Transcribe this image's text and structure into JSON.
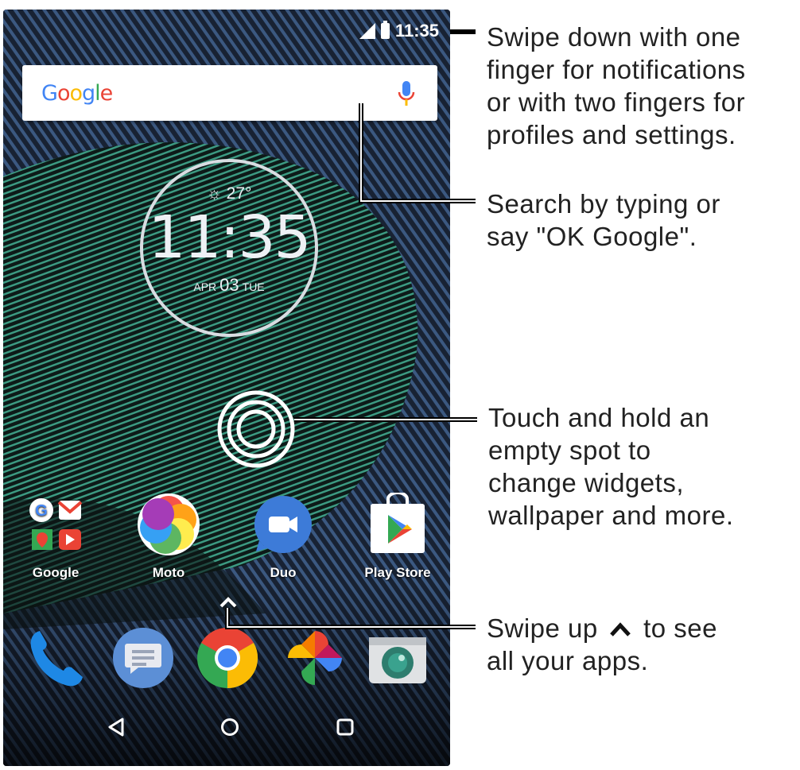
{
  "status_bar": {
    "time": "11:35",
    "signal_icon": "signal-icon",
    "battery_icon": "battery-icon"
  },
  "search_bar": {
    "logo": "Google",
    "mic_icon": "mic-icon"
  },
  "clock_widget": {
    "weather": "27°",
    "weather_icon": "sun-icon",
    "time": "11:35",
    "month": "APR",
    "day": "03",
    "weekday": "TUE"
  },
  "home_apps": [
    {
      "label": "Google",
      "icon": "google-folder-icon"
    },
    {
      "label": "Moto",
      "icon": "moto-icon"
    },
    {
      "label": "Duo",
      "icon": "duo-icon"
    },
    {
      "label": "Play Store",
      "icon": "play-store-icon"
    }
  ],
  "dock": [
    {
      "name": "Phone",
      "icon": "phone-icon"
    },
    {
      "name": "Messages",
      "icon": "messages-icon"
    },
    {
      "name": "Chrome",
      "icon": "chrome-icon"
    },
    {
      "name": "Photos",
      "icon": "photos-icon"
    },
    {
      "name": "Camera",
      "icon": "camera-icon"
    }
  ],
  "nav_bar": {
    "back_icon": "back-icon",
    "home_icon": "home-icon",
    "recents_icon": "recents-icon"
  },
  "callouts": {
    "notifications": [
      "Swipe down with one",
      "finger for notifications",
      "or with two fingers for",
      "profiles and settings."
    ],
    "search": [
      "Search by typing or",
      "say \"OK Google\"."
    ],
    "touch_hold": [
      "Touch and hold an",
      "empty spot to",
      "change widgets,",
      "wallpaper and more."
    ],
    "swipe_up_before": "Swipe up",
    "swipe_up_after": "to see",
    "swipe_up_line2": "all your apps."
  },
  "colors": {
    "wallpaper_teal": "#2f8f7a",
    "wallpaper_blue": "#33507a",
    "google_blue": "#4285F4",
    "google_red": "#EA4335",
    "google_yellow": "#FBBC05",
    "google_green": "#34A853"
  }
}
